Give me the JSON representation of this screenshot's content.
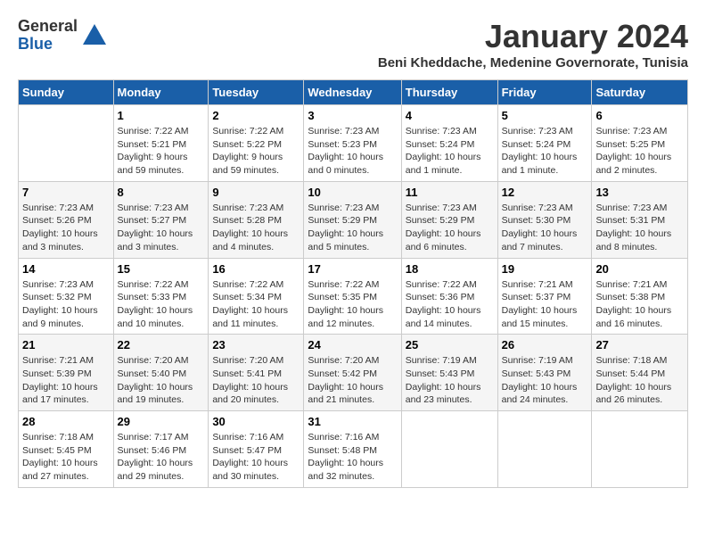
{
  "header": {
    "logo_general": "General",
    "logo_blue": "Blue",
    "month_title": "January 2024",
    "location": "Beni Kheddache, Medenine Governorate, Tunisia"
  },
  "days_of_week": [
    "Sunday",
    "Monday",
    "Tuesday",
    "Wednesday",
    "Thursday",
    "Friday",
    "Saturday"
  ],
  "weeks": [
    [
      {
        "day": "",
        "content": ""
      },
      {
        "day": "1",
        "content": "Sunrise: 7:22 AM\nSunset: 5:21 PM\nDaylight: 9 hours\nand 59 minutes."
      },
      {
        "day": "2",
        "content": "Sunrise: 7:22 AM\nSunset: 5:22 PM\nDaylight: 9 hours\nand 59 minutes."
      },
      {
        "day": "3",
        "content": "Sunrise: 7:23 AM\nSunset: 5:23 PM\nDaylight: 10 hours\nand 0 minutes."
      },
      {
        "day": "4",
        "content": "Sunrise: 7:23 AM\nSunset: 5:24 PM\nDaylight: 10 hours\nand 1 minute."
      },
      {
        "day": "5",
        "content": "Sunrise: 7:23 AM\nSunset: 5:24 PM\nDaylight: 10 hours\nand 1 minute."
      },
      {
        "day": "6",
        "content": "Sunrise: 7:23 AM\nSunset: 5:25 PM\nDaylight: 10 hours\nand 2 minutes."
      }
    ],
    [
      {
        "day": "7",
        "content": "Sunrise: 7:23 AM\nSunset: 5:26 PM\nDaylight: 10 hours\nand 3 minutes."
      },
      {
        "day": "8",
        "content": "Sunrise: 7:23 AM\nSunset: 5:27 PM\nDaylight: 10 hours\nand 3 minutes."
      },
      {
        "day": "9",
        "content": "Sunrise: 7:23 AM\nSunset: 5:28 PM\nDaylight: 10 hours\nand 4 minutes."
      },
      {
        "day": "10",
        "content": "Sunrise: 7:23 AM\nSunset: 5:29 PM\nDaylight: 10 hours\nand 5 minutes."
      },
      {
        "day": "11",
        "content": "Sunrise: 7:23 AM\nSunset: 5:29 PM\nDaylight: 10 hours\nand 6 minutes."
      },
      {
        "day": "12",
        "content": "Sunrise: 7:23 AM\nSunset: 5:30 PM\nDaylight: 10 hours\nand 7 minutes."
      },
      {
        "day": "13",
        "content": "Sunrise: 7:23 AM\nSunset: 5:31 PM\nDaylight: 10 hours\nand 8 minutes."
      }
    ],
    [
      {
        "day": "14",
        "content": "Sunrise: 7:23 AM\nSunset: 5:32 PM\nDaylight: 10 hours\nand 9 minutes."
      },
      {
        "day": "15",
        "content": "Sunrise: 7:22 AM\nSunset: 5:33 PM\nDaylight: 10 hours\nand 10 minutes."
      },
      {
        "day": "16",
        "content": "Sunrise: 7:22 AM\nSunset: 5:34 PM\nDaylight: 10 hours\nand 11 minutes."
      },
      {
        "day": "17",
        "content": "Sunrise: 7:22 AM\nSunset: 5:35 PM\nDaylight: 10 hours\nand 12 minutes."
      },
      {
        "day": "18",
        "content": "Sunrise: 7:22 AM\nSunset: 5:36 PM\nDaylight: 10 hours\nand 14 minutes."
      },
      {
        "day": "19",
        "content": "Sunrise: 7:21 AM\nSunset: 5:37 PM\nDaylight: 10 hours\nand 15 minutes."
      },
      {
        "day": "20",
        "content": "Sunrise: 7:21 AM\nSunset: 5:38 PM\nDaylight: 10 hours\nand 16 minutes."
      }
    ],
    [
      {
        "day": "21",
        "content": "Sunrise: 7:21 AM\nSunset: 5:39 PM\nDaylight: 10 hours\nand 17 minutes."
      },
      {
        "day": "22",
        "content": "Sunrise: 7:20 AM\nSunset: 5:40 PM\nDaylight: 10 hours\nand 19 minutes."
      },
      {
        "day": "23",
        "content": "Sunrise: 7:20 AM\nSunset: 5:41 PM\nDaylight: 10 hours\nand 20 minutes."
      },
      {
        "day": "24",
        "content": "Sunrise: 7:20 AM\nSunset: 5:42 PM\nDaylight: 10 hours\nand 21 minutes."
      },
      {
        "day": "25",
        "content": "Sunrise: 7:19 AM\nSunset: 5:43 PM\nDaylight: 10 hours\nand 23 minutes."
      },
      {
        "day": "26",
        "content": "Sunrise: 7:19 AM\nSunset: 5:43 PM\nDaylight: 10 hours\nand 24 minutes."
      },
      {
        "day": "27",
        "content": "Sunrise: 7:18 AM\nSunset: 5:44 PM\nDaylight: 10 hours\nand 26 minutes."
      }
    ],
    [
      {
        "day": "28",
        "content": "Sunrise: 7:18 AM\nSunset: 5:45 PM\nDaylight: 10 hours\nand 27 minutes."
      },
      {
        "day": "29",
        "content": "Sunrise: 7:17 AM\nSunset: 5:46 PM\nDaylight: 10 hours\nand 29 minutes."
      },
      {
        "day": "30",
        "content": "Sunrise: 7:16 AM\nSunset: 5:47 PM\nDaylight: 10 hours\nand 30 minutes."
      },
      {
        "day": "31",
        "content": "Sunrise: 7:16 AM\nSunset: 5:48 PM\nDaylight: 10 hours\nand 32 minutes."
      },
      {
        "day": "",
        "content": ""
      },
      {
        "day": "",
        "content": ""
      },
      {
        "day": "",
        "content": ""
      }
    ]
  ]
}
